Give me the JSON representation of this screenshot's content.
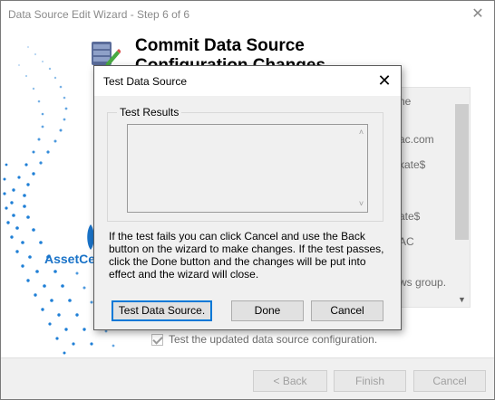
{
  "wizard": {
    "title": "Data Source Edit Wizard - Step 6 of 6",
    "close_glyph": "✕",
    "header_title": "Commit Data Source Configuration Changes",
    "logo_text": "AssetCe",
    "summary_lines": [
      "ne",
      "ac.com",
      "kate$",
      "ate$",
      "AC",
      "ws group."
    ],
    "checkbox_label": "Test the updated data source configuration.",
    "checkbox_checked": true,
    "buttons": {
      "back": "< Back",
      "finish": "Finish",
      "cancel": "Cancel"
    }
  },
  "dialog": {
    "title": "Test Data Source",
    "close_glyph": "✕",
    "group_label": "Test Results",
    "results_text": "",
    "message": "If the test fails you can click Cancel and use the Back button on the wizard to make changes. If the test passes, click  the Done button and the changes will be put into effect and the wizard will close.",
    "buttons": {
      "test": "Test Data Source.",
      "done": "Done",
      "cancel": "Cancel"
    }
  },
  "icons": {
    "header": "database-edit-icon",
    "logo": "assetcentral-logo-icon"
  },
  "colors": {
    "accent": "#0078d7",
    "logo_blue": "#1a73c8",
    "wave_blue": "#1f7fd6"
  }
}
